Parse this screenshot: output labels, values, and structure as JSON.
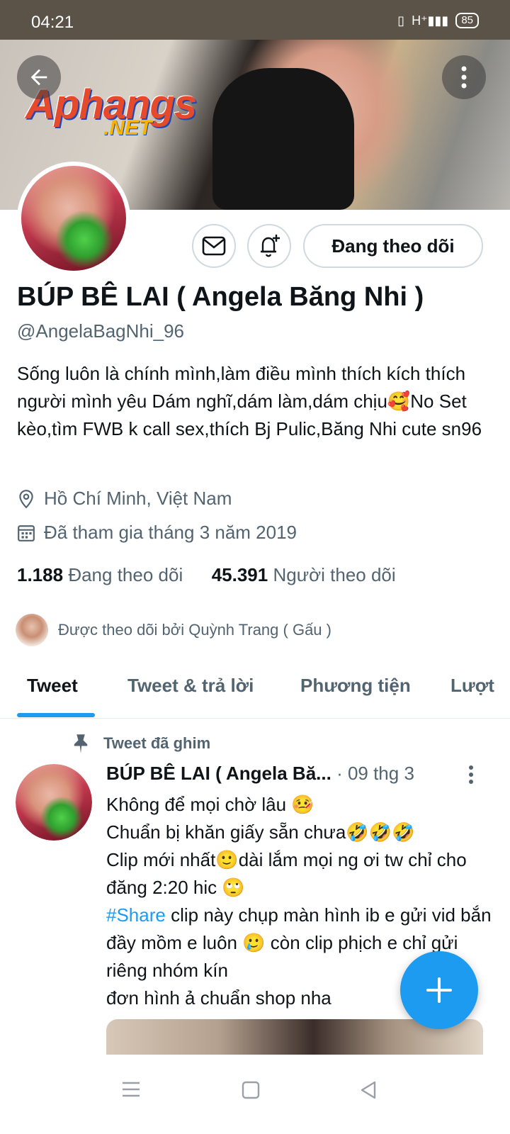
{
  "status_bar": {
    "time": "04:21",
    "battery": "85"
  },
  "banner": {
    "logo_main": "Aphangs",
    "logo_sub": ".NET"
  },
  "profile": {
    "follow_button": "Đang theo dõi",
    "name": "BÚP BÊ LAI ( Angela Băng Nhi )",
    "handle": "@AngelaBagNhi_96",
    "bio": "Sống luôn là chính mình,làm điều mình thích kích thích người mình yêu Dám nghĩ,dám làm,dám chịu🥰No Set kèo,tìm FWB k call sex,thích Bj Pulic,Băng Nhi cute sn96",
    "location": "Hồ Chí Minh, Việt Nam",
    "joined": "Đã tham gia tháng 3 năm 2019",
    "following_count": "1.188",
    "following_label": "Đang theo dõi",
    "followers_count": "45.391",
    "followers_label": "Người theo dõi",
    "followed_by": "Được theo dõi bởi Quỳnh Trang ( Gấu )"
  },
  "tabs": [
    "Tweet",
    "Tweet & trả lời",
    "Phương tiện",
    "Lượt"
  ],
  "pinned_tweet": {
    "pinned_label": "Tweet đã ghim",
    "author": "BÚP BÊ LAI ( Angela Bă...",
    "date": "· 09 thg 3",
    "lines": [
      "Không để mọi chờ lâu 🤒",
      "Chuẩn bị khăn giấy sẵn chưa🤣🤣🤣",
      "Clip mới nhất🙂dài lắm mọi ng ơi tw chỉ cho đăng 2:20 hic 🙄",
      "clip này chụp màn hình ib e gửi vid bắn đầy mồm e luôn 🥲 còn clip phịch e chỉ gửi riêng nhóm kín",
      "đơn hình ả chuẩn shop nha"
    ],
    "hashtag": "#Share"
  }
}
